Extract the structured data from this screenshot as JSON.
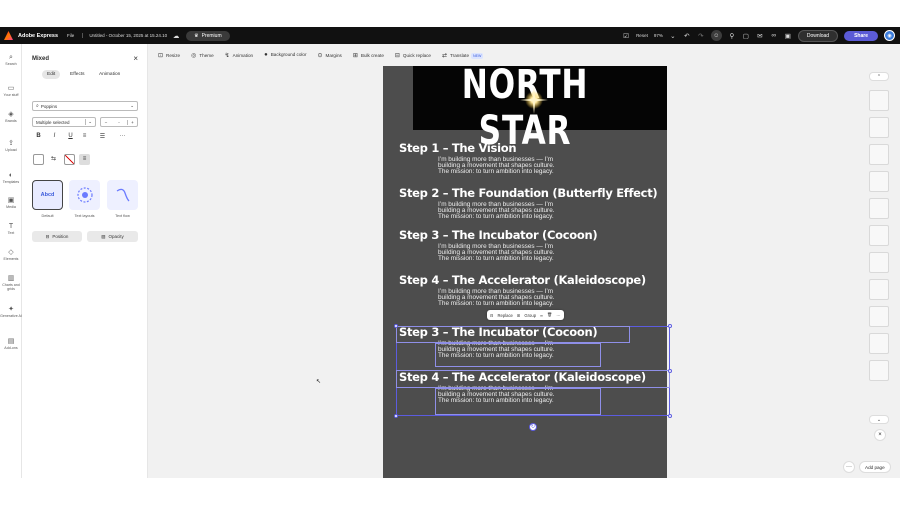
{
  "topbar": {
    "app_name": "Adobe Express",
    "file_menu": "File",
    "doc_title": "Untitled - October 15, 2025 at 15.24.10",
    "premium": "Premium",
    "reset": "Reset",
    "zoom": "97%",
    "download": "Download",
    "share": "Share"
  },
  "rail": [
    {
      "icon": "search-icon",
      "glyph": "⌕",
      "label": "Search"
    },
    {
      "icon": "folder-icon",
      "glyph": "▭",
      "label": "Your stuff"
    },
    {
      "icon": "brand-icon",
      "glyph": "◈",
      "label": "Brands"
    },
    {
      "icon": "upload-icon",
      "glyph": "⇪",
      "label": "Upload"
    },
    {
      "icon": "templates-icon",
      "glyph": "◐",
      "label": "Templates"
    },
    {
      "icon": "media-icon",
      "glyph": "▣",
      "label": "Media"
    },
    {
      "icon": "text-icon",
      "glyph": "T",
      "label": "Text"
    },
    {
      "icon": "elements-icon",
      "glyph": "◇",
      "label": "Elements"
    },
    {
      "icon": "charts-icon",
      "glyph": "▥",
      "label": "Charts and grids"
    },
    {
      "icon": "generative-icon",
      "glyph": "✦",
      "label": "Generative AI"
    },
    {
      "icon": "addons-icon",
      "glyph": "▤",
      "label": "Add-ons"
    }
  ],
  "panel": {
    "title": "Mixed",
    "tabs": [
      "Edit",
      "Effects",
      "Animation"
    ],
    "font": "Poppins",
    "weight": "Multiple selected",
    "size_value": "-",
    "text_styles": [
      "Default",
      "Text layouts",
      "Text flow"
    ],
    "card_default_text": "Abcd",
    "position_btn": "Position",
    "opacity_btn": "Opacity"
  },
  "toolbar": [
    {
      "icon": "resize-icon",
      "glyph": "⊡",
      "label": "Resize"
    },
    {
      "icon": "theme-icon",
      "glyph": "◎",
      "label": "Theme"
    },
    {
      "icon": "animation-icon",
      "glyph": "↯",
      "label": "Animation"
    },
    {
      "icon": "background-color-icon",
      "glyph": "●",
      "label": "Background color"
    },
    {
      "icon": "margins-icon",
      "glyph": "⊙",
      "label": "Margins"
    },
    {
      "icon": "bulk-create-icon",
      "glyph": "⊞",
      "label": "Bulk create"
    },
    {
      "icon": "quick-replace-icon",
      "glyph": "⊟",
      "label": "Quick replace"
    },
    {
      "icon": "translate-icon",
      "glyph": "⇄",
      "label": "Translate"
    }
  ],
  "new_badge": "NEW",
  "canvas": {
    "title": "NORTH STAR",
    "steps": [
      {
        "title": "Step 1 – The Vision",
        "lines": [
          "I’m building more than businesses — I’m",
          "building a movement that shapes culture.",
          "The mission: to turn ambition into legacy."
        ]
      },
      {
        "title": "Step 2 – The Foundation (Butterfly Effect)",
        "lines": [
          "I’m building more than businesses — I’m",
          "building a movement that shapes culture.",
          "The mission: to turn ambition into legacy."
        ]
      },
      {
        "title": "Step 3 – The Incubator (Cocoon)",
        "lines": [
          "I’m building more than businesses — I’m",
          "building a movement that shapes culture.",
          "The mission: to turn ambition into legacy."
        ]
      },
      {
        "title": "Step 4 – The Accelerator (Kaleidoscope)",
        "lines": [
          "I’m building more than businesses — I’m",
          "building a movement that shapes culture.",
          "The mission: to turn ambition into legacy."
        ]
      },
      {
        "title": "Step 3 – The Incubator (Cocoon)",
        "lines": [
          "I’m building more than businesses — I’m",
          "building a movement that shapes culture.",
          "The mission: to turn ambition into legacy."
        ]
      },
      {
        "title": "Step 4 – The Accelerator (Kaleidoscope)",
        "lines": [
          "I’m building more than businesses — I’m",
          "building a movement that shapes culture.",
          "The mission: to turn ambition into legacy."
        ]
      }
    ]
  },
  "context_menu": {
    "replace": "Replace",
    "group": "Group"
  },
  "add_page": "Add page"
}
